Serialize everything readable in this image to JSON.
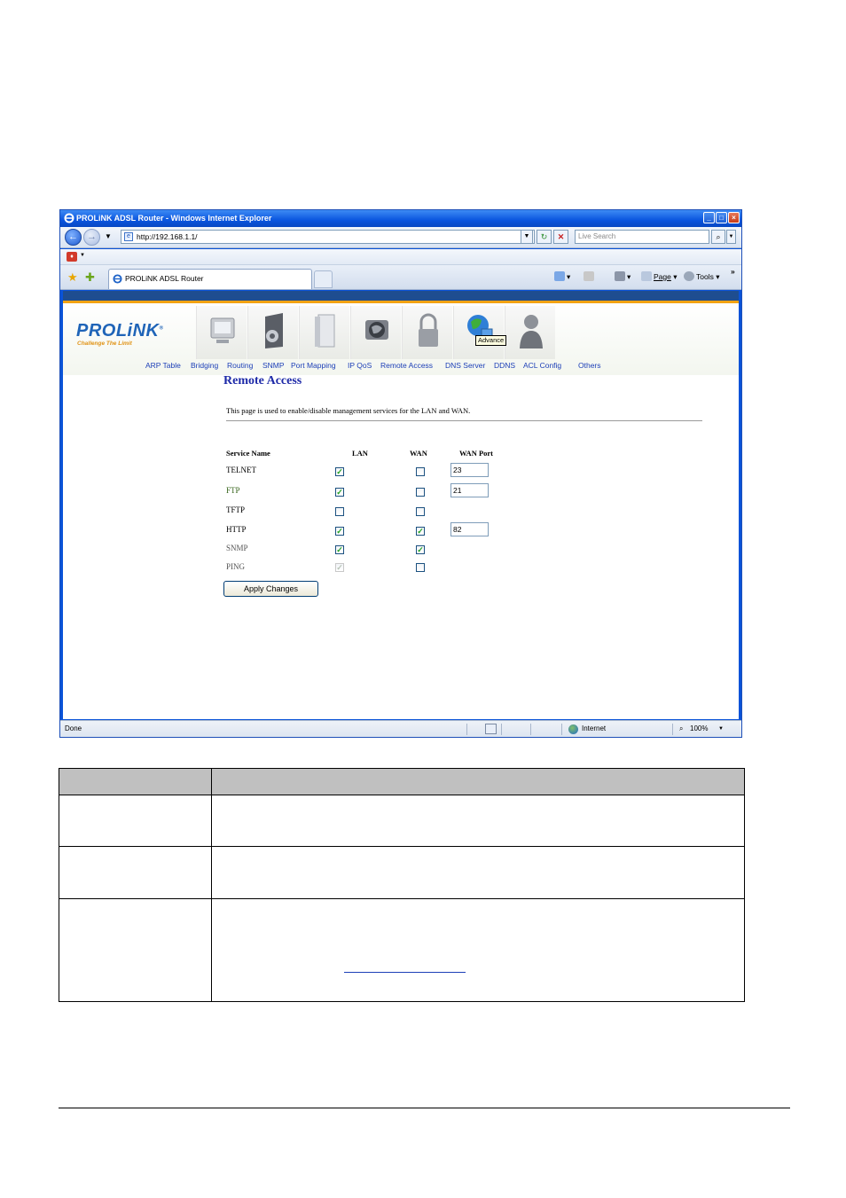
{
  "window": {
    "title": "PROLiNK ADSL Router - Windows Internet Explorer",
    "address": "http://192.168.1.1/",
    "search_placeholder": "Live Search",
    "tab_title": "PROLiNK ADSL Router",
    "cmd_page": "Page",
    "cmd_tools": "Tools",
    "status_text": "Done",
    "zone": "Internet",
    "zoom": "100%"
  },
  "brand": {
    "logo": "PROLiNK",
    "slogan": "Challenge The Limit"
  },
  "tooltip": "Advance",
  "nav": [
    "ARP Table",
    "Bridging",
    "Routing",
    "SNMP",
    "Port Mapping",
    "IP QoS",
    "Remote Access",
    "DNS Server",
    "DDNS",
    "ACL Config",
    "Others"
  ],
  "page": {
    "title": "Remote Access",
    "description": "This page is used to enable/disable management services for the LAN and WAN.",
    "headers": {
      "service": "Service Name",
      "lan": "LAN",
      "wan": "WAN",
      "port": "WAN Port"
    },
    "services": [
      {
        "name": "TELNET",
        "lan": true,
        "wan": false,
        "port": "23"
      },
      {
        "name": "FTP",
        "lan": true,
        "wan": false,
        "port": "21"
      },
      {
        "name": "TFTP",
        "lan": false,
        "wan": false,
        "port": null
      },
      {
        "name": "HTTP",
        "lan": true,
        "wan": true,
        "port": "82"
      },
      {
        "name": "SNMP",
        "lan": true,
        "wan": true,
        "port": null
      },
      {
        "name": "PING",
        "lan": true,
        "wan": false,
        "port": null,
        "lan_disabled": true
      }
    ],
    "apply_label": "Apply Changes"
  },
  "colors": {
    "title_blue": "#1e2aa8",
    "nav_blue": "#1c3fb7",
    "accent_orange": "#f2a214",
    "header_navy": "#1e4d90"
  }
}
